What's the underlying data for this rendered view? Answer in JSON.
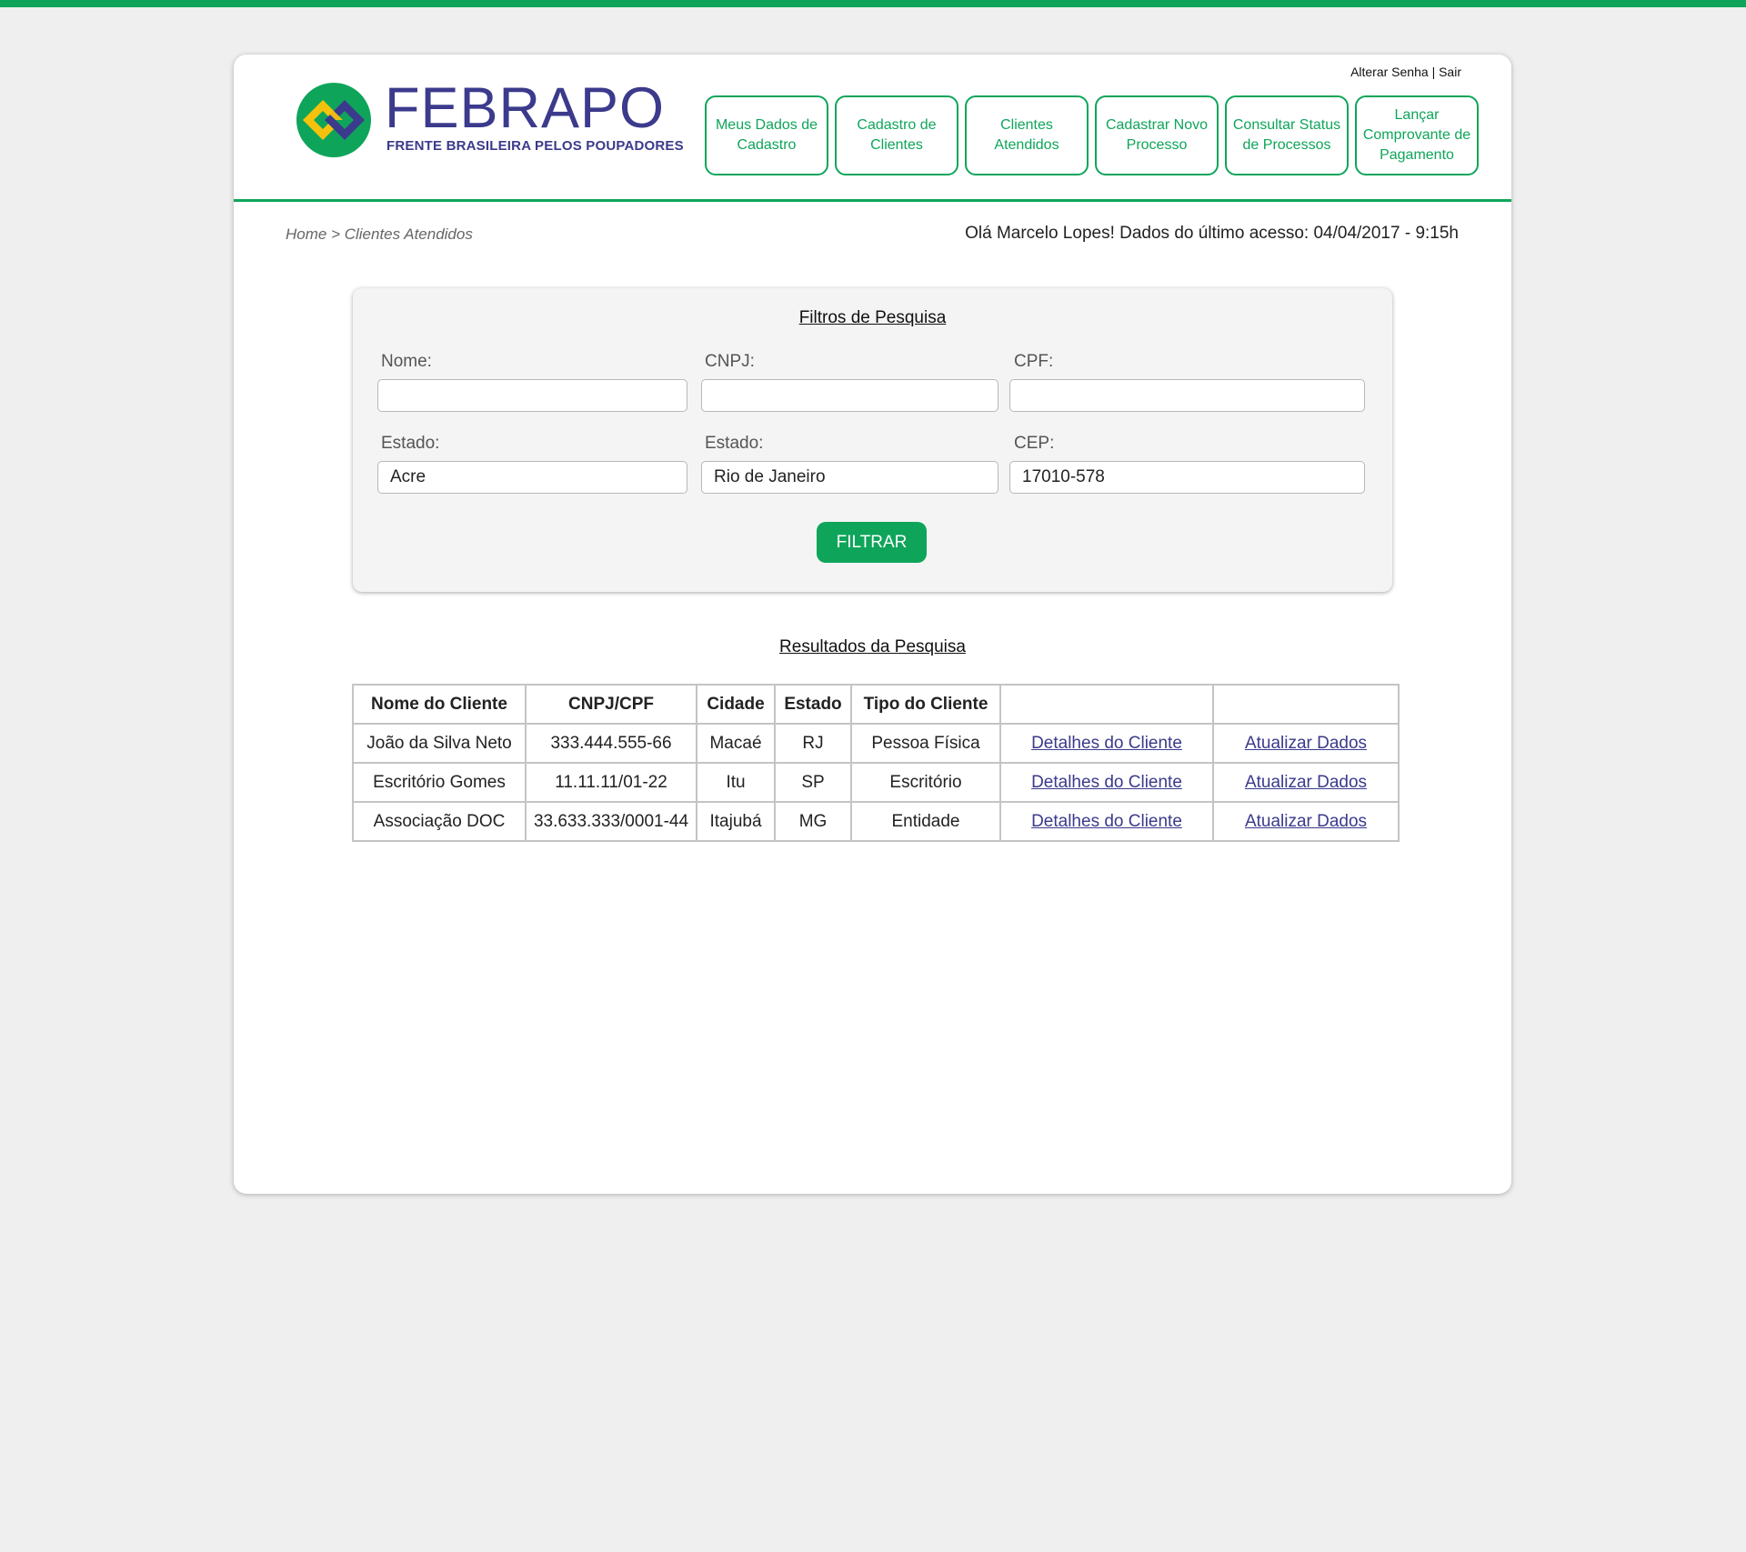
{
  "header": {
    "logo_title": "FEBRAPO",
    "logo_subtitle": "FRENTE BRASILEIRA PELOS POUPADORES",
    "top_links": {
      "change_password": "Alterar Senha",
      "separator": "|",
      "logout": "Sair"
    },
    "nav": [
      {
        "label": "Meus Dados de Cadastro"
      },
      {
        "label": "Cadastro de Clientes"
      },
      {
        "label": "Clientes Atendidos"
      },
      {
        "label": "Cadastrar Novo Processo"
      },
      {
        "label": "Consultar Status de Processos"
      },
      {
        "label": "Lançar Comprovante de Pagamento"
      }
    ]
  },
  "breadcrumb": "Home > Clientes Atendidos",
  "welcome": "Olá Marcelo Lopes! Dados do último acesso: 04/04/2017 - 9:15h",
  "filters": {
    "title": "Filtros de Pesquisa",
    "fields": [
      {
        "label": "Nome:",
        "value": ""
      },
      {
        "label": "CNPJ:",
        "value": ""
      },
      {
        "label": "CPF:",
        "value": ""
      },
      {
        "label": "Estado:",
        "value": "Acre"
      },
      {
        "label": "Estado:",
        "value": "Rio de Janeiro"
      },
      {
        "label": "CEP:",
        "value": "17010-578"
      }
    ],
    "button": "FILTRAR"
  },
  "results": {
    "title": "Resultados da Pesquisa",
    "columns": [
      "Nome do Cliente",
      "CNPJ/CPF",
      "Cidade",
      "Estado",
      "Tipo do Cliente",
      "",
      ""
    ],
    "rows": [
      {
        "name": "João da Silva Neto",
        "doc": "333.444.555-66",
        "city": "Macaé",
        "state": "RJ",
        "type": "Pessoa Física",
        "details": "Detalhes do Cliente",
        "update": "Atualizar Dados"
      },
      {
        "name": "Escritório Gomes",
        "doc": "11.11.11/01-22",
        "city": "Itu",
        "state": "SP",
        "type": "Escritório",
        "details": "Detalhes do Cliente",
        "update": "Atualizar Dados"
      },
      {
        "name": "Associação DOC",
        "doc": "33.633.333/0001-44",
        "city": "Itajubá",
        "state": "MG",
        "type": "Entidade",
        "details": "Detalhes do Cliente",
        "update": "Atualizar Dados"
      }
    ]
  },
  "colors": {
    "accent_green": "#0ea55a",
    "brand_blue": "#3b3a8c",
    "brand_yellow": "#f4c20d"
  }
}
